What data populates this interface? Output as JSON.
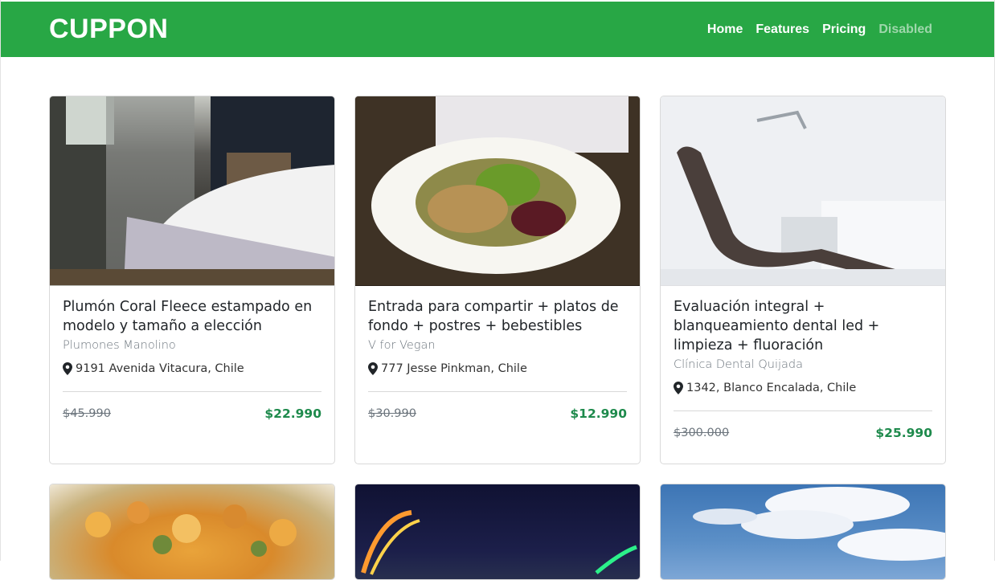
{
  "navbar": {
    "brand": "CUPPON",
    "links": [
      {
        "label": "Home",
        "disabled": false
      },
      {
        "label": "Features",
        "disabled": false
      },
      {
        "label": "Pricing",
        "disabled": false
      },
      {
        "label": "Disabled",
        "disabled": true
      }
    ]
  },
  "theme": {
    "accent": "#28a745",
    "price_green": "#1e8a4c"
  },
  "cards": [
    {
      "title": "Plumón Coral Fleece estampado en modelo y tamaño a elección",
      "vendor": "Plumones Manolino",
      "address": "9191 Avenida Vitacura, Chile",
      "old_price": "$45.990",
      "new_price": "$22.990",
      "image": "bedroom-photo"
    },
    {
      "title": "Entrada para compartir + platos de fondo + postres + bebestibles",
      "vendor": "V for Vegan",
      "address": "777 Jesse Pinkman, Chile",
      "old_price": "$30.990",
      "new_price": "$12.990",
      "image": "vegan-dish-photo"
    },
    {
      "title": "Evaluación integral + blanqueamiento dental led + limpieza + fluoración",
      "vendor": "Clínica Dental Quijada",
      "address": "1342, Blanco Encalada, Chile",
      "old_price": "$300.000",
      "new_price": "$25.990",
      "image": "dental-chair-photo"
    },
    {
      "image": "food-photo"
    },
    {
      "image": "night-photo"
    },
    {
      "image": "sky-clouds-photo"
    }
  ]
}
